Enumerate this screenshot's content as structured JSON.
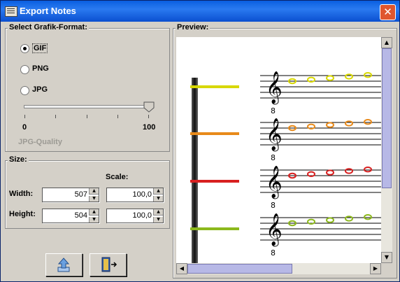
{
  "window": {
    "title": "Export Notes"
  },
  "format_panel": {
    "legend": "Select Grafik-Format:",
    "options": [
      {
        "label": "GIF",
        "selected": true
      },
      {
        "label": "PNG",
        "selected": false
      },
      {
        "label": "JPG",
        "selected": false
      }
    ],
    "quality_slider": {
      "min_label": "0",
      "max_label": "100",
      "value": 100,
      "label": "JPG-Quality"
    }
  },
  "size_panel": {
    "legend": "Size:",
    "scale_label": "Scale:",
    "width_label": "Width:",
    "height_label": "Height:",
    "width_value": "507",
    "height_value": "504",
    "width_scale": "100,0",
    "height_scale": "100,0"
  },
  "preview_panel": {
    "legend": "Preview:",
    "staff_colors": [
      "#d8d800",
      "#e88a1a",
      "#d82020",
      "#8cb81c"
    ],
    "clef_subscript": "8"
  },
  "buttons": {
    "export_icon": "export-arrow-icon",
    "exit_icon": "exit-door-icon"
  },
  "colors": {
    "title_bar": "#0b55d8",
    "close": "#e0562e",
    "scroll_thumb": "#b7b8e6"
  }
}
